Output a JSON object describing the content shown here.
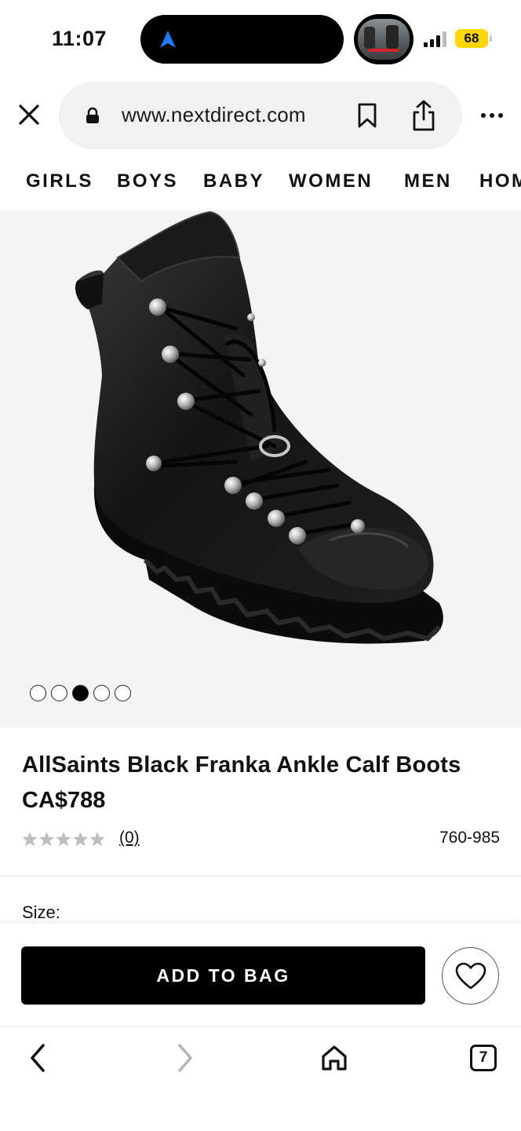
{
  "status": {
    "time": "11:07",
    "battery": "68",
    "colors": {
      "battery": "#ffd60a",
      "nav_arrow": "#1e7bff"
    }
  },
  "browser": {
    "url": "www.nextdirect.com"
  },
  "categories": [
    "GIRLS",
    "BOYS",
    "BABY",
    "WOMEN",
    "MEN",
    "HOME"
  ],
  "gallery": {
    "total_images": 5,
    "active_index": 2
  },
  "product": {
    "title": "AllSaints Black Franka Ankle Calf Boots",
    "price": "CA$788",
    "rating": 0,
    "reviews_label": "(0)",
    "item_number": "760-985",
    "size_label": "Size:"
  },
  "actions": {
    "add_to_bag": "ADD TO BAG"
  },
  "toolbar": {
    "tabs_count": "7"
  }
}
